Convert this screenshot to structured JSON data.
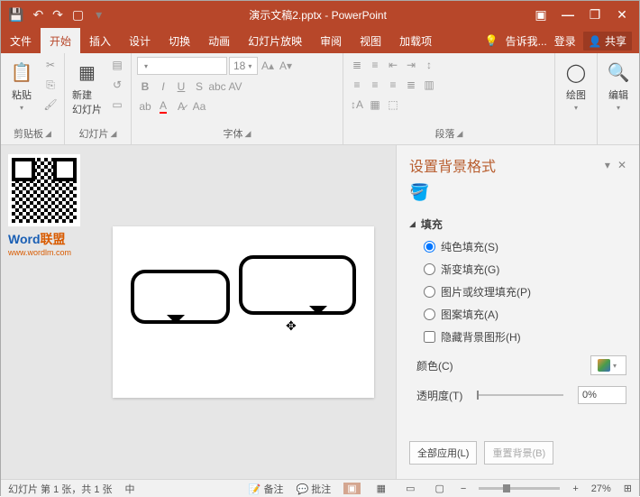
{
  "titlebar": {
    "title": "演示文稿2.pptx - PowerPoint"
  },
  "menu": {
    "file": "文件",
    "home": "开始",
    "insert": "插入",
    "design": "设计",
    "transition": "切换",
    "animation": "动画",
    "slideshow": "幻灯片放映",
    "review": "审阅",
    "view": "视图",
    "addins": "加载项",
    "tellme": "告诉我...",
    "signin": "登录",
    "share": "共享"
  },
  "ribbon": {
    "clipboard": {
      "label": "剪贴板",
      "paste": "粘贴"
    },
    "slides": {
      "label": "幻灯片",
      "new": "新建\n幻灯片"
    },
    "font": {
      "label": "字体",
      "size": "18"
    },
    "paragraph": {
      "label": "段落"
    },
    "drawing": {
      "label": "绘图",
      "btn": "绘图"
    },
    "editing": {
      "label": "编辑",
      "btn": "编辑"
    }
  },
  "logo": {
    "w": "Word",
    "rest": "联盟",
    "sub": "www.wordlm.com"
  },
  "panel": {
    "title": "设置背景格式",
    "fill_section": "填充",
    "solid": "纯色填充(S)",
    "gradient": "渐变填充(G)",
    "picture": "图片或纹理填充(P)",
    "pattern": "图案填充(A)",
    "hide": "隐藏背景图形(H)",
    "color": "颜色(C)",
    "transparency": "透明度(T)",
    "trans_value": "0%",
    "apply_all": "全部应用(L)",
    "reset": "重置背景(B)"
  },
  "status": {
    "slide": "幻灯片 第 1 张，共 1 张",
    "lang": "中",
    "notes": "备注",
    "comments": "批注",
    "zoom": "27%"
  }
}
